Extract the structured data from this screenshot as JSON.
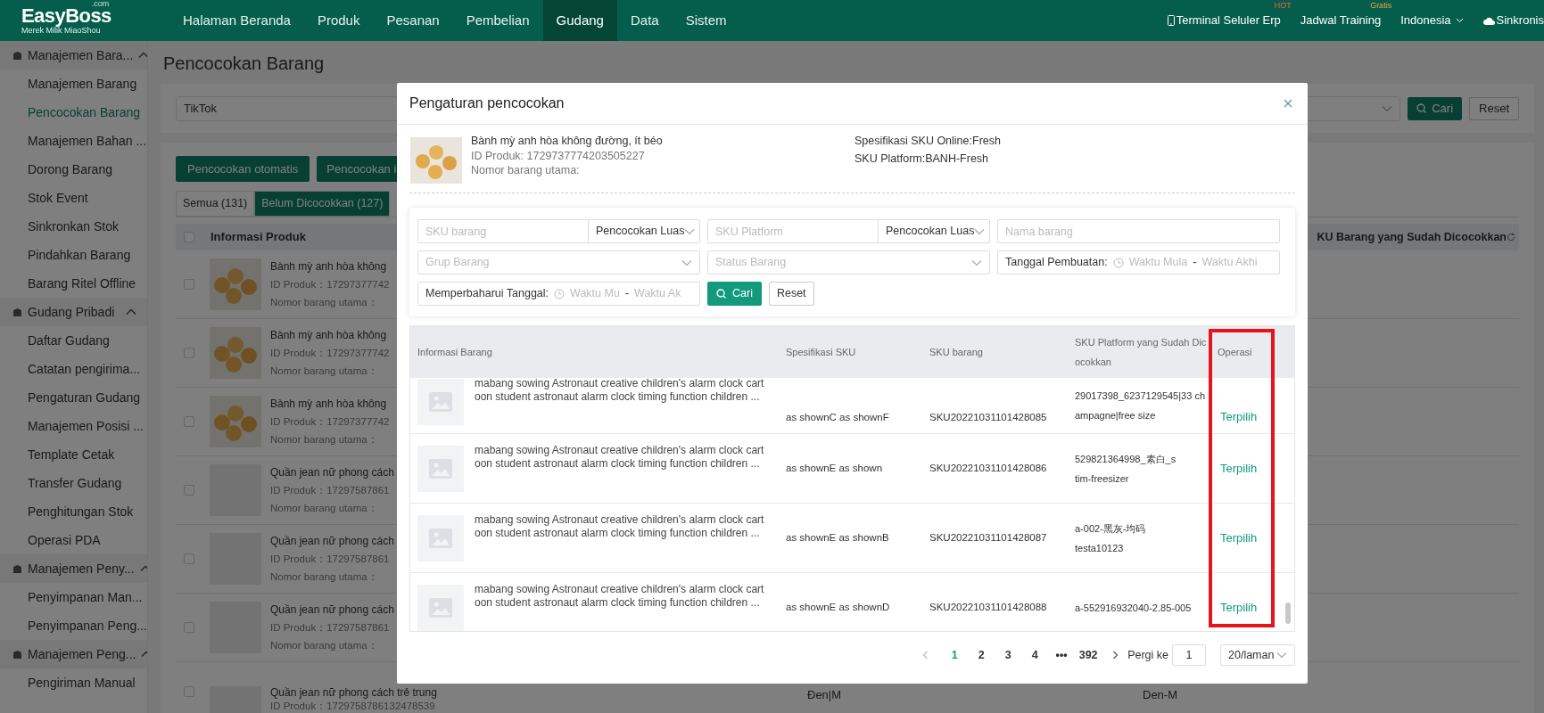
{
  "top_bar": {
    "logo": "EasyBoss",
    "logo_suffix": ".com",
    "logo_subtitle": "Merek Milik MiaoShou",
    "nav": [
      {
        "label": "Halaman Beranda",
        "selected": false
      },
      {
        "label": "Produk",
        "selected": false
      },
      {
        "label": "Pesanan",
        "selected": false
      },
      {
        "label": "Pembelian",
        "selected": false
      },
      {
        "label": "Gudang",
        "selected": true
      },
      {
        "label": "Data",
        "selected": false
      },
      {
        "label": "Sistem",
        "selected": false
      }
    ],
    "right": [
      {
        "kind": "phone",
        "label": "Terminal Seluler Erp",
        "badge": "HOT"
      },
      {
        "kind": "plain",
        "label": "Jadwal Training",
        "badge": "Gratis"
      },
      {
        "kind": "dropdown",
        "label": "Indonesia"
      },
      {
        "kind": "cloud",
        "label": "Sinkronis"
      }
    ]
  },
  "sidebar": {
    "groups": [
      {
        "label": "Manajemen Bara...",
        "expanded": true,
        "items": [
          {
            "label": "Manajemen Barang",
            "selected": false
          },
          {
            "label": "Pencocokan Barang",
            "selected": true
          },
          {
            "label": "Manajemen Bahan ...",
            "selected": false
          },
          {
            "label": "Dorong Barang",
            "selected": false
          },
          {
            "label": "Stok Event",
            "selected": false
          },
          {
            "label": "Sinkronkan Stok",
            "selected": false
          },
          {
            "label": "Pindahkan Barang",
            "selected": false
          },
          {
            "label": "Barang Ritel Offline",
            "selected": false
          }
        ]
      },
      {
        "label": "Gudang Pribadi",
        "expanded": true,
        "items": [
          {
            "label": "Daftar Gudang",
            "selected": false
          },
          {
            "label": "Catatan pengirima...",
            "selected": false
          },
          {
            "label": "Pengaturan Gudang",
            "selected": false
          },
          {
            "label": "Manajemen Posisi ...",
            "selected": false
          },
          {
            "label": "Template Cetak",
            "selected": false
          },
          {
            "label": "Transfer Gudang",
            "selected": false
          },
          {
            "label": "Penghitungan Stok",
            "selected": false
          },
          {
            "label": "Operasi PDA",
            "selected": false
          }
        ]
      },
      {
        "label": "Manajemen Peny...",
        "expanded": true,
        "items": [
          {
            "label": "Penyimpanan Man...",
            "selected": false
          },
          {
            "label": "Penyimpanan Peng...",
            "selected": false
          }
        ]
      },
      {
        "label": "Manajemen Peng...",
        "expanded": true,
        "items": [
          {
            "label": "Pengiriman Manual",
            "selected": false
          }
        ]
      }
    ]
  },
  "page": {
    "title": "Pencocokan Barang",
    "filter": {
      "platform": "TikTok",
      "search_button": "Cari",
      "reset_button": "Reset"
    },
    "actions": [
      "Pencocokan otomatis",
      "Pencocokan i"
    ],
    "tabs": [
      {
        "label": "Semua (131)",
        "selected": false
      },
      {
        "label": "Belum Dicocokkan (127)",
        "selected": true
      }
    ],
    "table": {
      "select_all_checked": false,
      "columns": [
        "Informasi Produk",
        "KU Barang yang Sudah Dicocokkan"
      ],
      "rows": [
        {
          "checked": false,
          "has_photo": true,
          "name": "Bành mỳ anh hòa không",
          "product_id": "ID Produk：17297377742",
          "main_number": "Nomor barang utama："
        },
        {
          "checked": false,
          "has_photo": true,
          "name": "Bành mỳ anh hòa không",
          "product_id": "ID Produk：17297377742",
          "main_number": "Nomor barang utama："
        },
        {
          "checked": false,
          "has_photo": true,
          "name": "Bành mỳ anh hòa không",
          "product_id": "ID Produk：17297377742",
          "main_number": "Nomor barang utama："
        },
        {
          "checked": false,
          "has_photo": false,
          "name": "Quần jean nữ phong cách",
          "product_id": "ID Produk：17297587861",
          "main_number": "Nomor barang utama："
        },
        {
          "checked": false,
          "has_photo": false,
          "name": "Quần jean nữ phong cách",
          "product_id": "ID Produk：17297587861",
          "main_number": "Nomor barang utama："
        },
        {
          "checked": false,
          "has_photo": false,
          "name": "Quần jean nữ phong cách",
          "product_id": "ID Produk：17297587861",
          "main_number": "Nomor barang utama："
        },
        {
          "checked": false,
          "has_photo": false,
          "name": "Quần jean nữ phong cách trẻ trung",
          "product_id": "ID Produk：1729758786132478539",
          "spec": "Đen|M",
          "matched_sku": "Den-M"
        }
      ]
    }
  },
  "modal": {
    "title": "Pengaturan pencocokan",
    "product": {
      "name": "Bành mỳ anh hòa không đường, ít béo",
      "product_id": "ID Produk: 1729737774203505227",
      "main_number": "Nomor barang utama:",
      "online_spec": "Spesifikasi SKU Online:Fresh",
      "platform_sku": "SKU Platform:BANH-Fresh"
    },
    "filters": {
      "sku_placeholder": "SKU barang",
      "sku_mode": "Pencocokan Luas",
      "platform_sku_placeholder": "SKU Platform",
      "platform_sku_mode": "Pencocokan Luas",
      "name_placeholder": "Nama barang",
      "group_placeholder": "Grup Barang",
      "status_placeholder": "Status Barang",
      "created_label": "Tanggal Pembuatan:",
      "created_start": "Waktu Mula",
      "created_end": "Waktu Akhi",
      "updated_label": "Memperbaharui Tanggal:",
      "updated_start": "Waktu Mu",
      "updated_end": "Waktu Ak",
      "range_separator": "-",
      "search_button": "Cari",
      "reset_button": "Reset"
    },
    "table": {
      "columns": [
        {
          "label": "Informasi Barang",
          "highlighted": false
        },
        {
          "label": "Spesifikasi SKU",
          "highlighted": false
        },
        {
          "label": "SKU barang",
          "highlighted": false
        },
        {
          "label": "SKU Platform yang Sudah Dic\nocokkan",
          "highlighted": false
        },
        {
          "label": "Operasi",
          "highlighted": true
        }
      ],
      "rows": [
        {
          "name": "mabang sowing Astronaut creative children's alarm clock cart\noon student astronaut alarm clock timing function children ...",
          "spec": "as shownC as shownF",
          "sku": "SKU20221031101428085",
          "platform_sku": "29017398_6237129545|33 ch\nampagne|free size",
          "action": "Terpilih"
        },
        {
          "name": "mabang sowing Astronaut creative children's alarm clock cart\noon student astronaut alarm clock timing function children ...",
          "spec": "as shownE as shown",
          "sku": "SKU20221031101428086",
          "platform_sku": "529821364998_素白_s\ntim-freesizer",
          "action": "Terpilih"
        },
        {
          "name": "mabang sowing Astronaut creative children's alarm clock cart\noon student astronaut alarm clock timing function children ...",
          "spec": "as shownE as shownB",
          "sku": "SKU20221031101428087",
          "platform_sku": "a-002-黑灰-均码\ntesta10123",
          "action": "Terpilih"
        },
        {
          "name": "mabang sowing Astronaut creative children's alarm clock cart\noon student astronaut alarm clock timing function children ...",
          "spec": "as shownE as shownD",
          "sku": "SKU20221031101428088",
          "platform_sku": "a-552916932040-2.85-005",
          "action": "Terpilih"
        }
      ]
    },
    "pagination": {
      "pages": [
        {
          "label": "1",
          "selected": true
        },
        {
          "label": "2",
          "selected": false
        },
        {
          "label": "3",
          "selected": false
        },
        {
          "label": "4",
          "selected": false
        },
        {
          "label": "•••",
          "selected": false
        },
        {
          "label": "392",
          "selected": false
        }
      ],
      "go_to_label": "Pergi ke",
      "go_to_value": "1",
      "page_size": "20/laman"
    }
  }
}
